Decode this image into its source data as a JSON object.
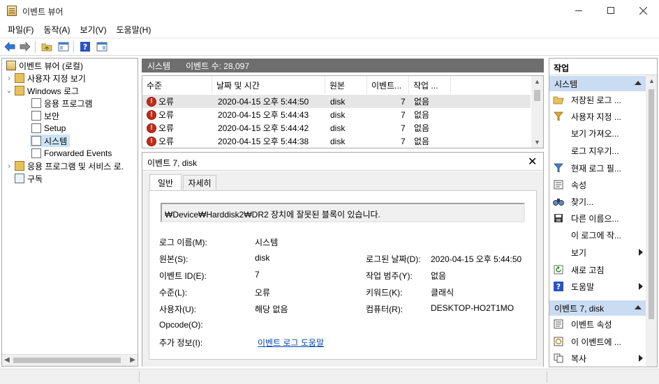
{
  "window": {
    "title": "이벤트 뷰어"
  },
  "menu": [
    "파일(F)",
    "동작(A)",
    "보기(V)",
    "도움말(H)"
  ],
  "tree": {
    "root": "이벤트 뷰어 (로컬)",
    "custom_views": "사용자 지정 보기",
    "windows_logs": "Windows 로그",
    "logs": [
      "응용 프로그램",
      "보안",
      "Setup",
      "시스템",
      "Forwarded Events"
    ],
    "app_services": "응용 프로그램 및 서비스 로.",
    "subscriptions": "구독"
  },
  "middle": {
    "log_name": "시스템",
    "event_count": "이벤트 수: 28,097"
  },
  "grid": {
    "columns": [
      "수준",
      "날짜 및 시간",
      "원본",
      "이벤트...",
      "작업 ..."
    ],
    "rows": [
      {
        "level": "오류",
        "datetime": "2020-04-15 오후 5:44:50",
        "source": "disk",
        "id": "7",
        "task": "없음"
      },
      {
        "level": "오류",
        "datetime": "2020-04-15 오후 5:44:43",
        "source": "disk",
        "id": "7",
        "task": "없음"
      },
      {
        "level": "오류",
        "datetime": "2020-04-15 오후 5:44:42",
        "source": "disk",
        "id": "7",
        "task": "없음"
      },
      {
        "level": "오류",
        "datetime": "2020-04-15 오후 5:44:38",
        "source": "disk",
        "id": "7",
        "task": "없음"
      }
    ]
  },
  "detail": {
    "title": "이벤트 7, disk",
    "tabs": [
      "일반",
      "자세히"
    ],
    "message": "₩Device₩Harddisk2₩DR2 장치에 잘못된 블록이 있습니다.",
    "fields": {
      "log_name_label": "로그 이름(M):",
      "log_name": "시스템",
      "source_label": "원본(S):",
      "source": "disk",
      "logged_label": "로그된 날짜(D):",
      "logged": "2020-04-15 오후 5:44:50",
      "event_id_label": "이벤트 ID(E):",
      "event_id": "7",
      "task_cat_label": "작업 범주(Y):",
      "task_cat": "없음",
      "level_label": "수준(L):",
      "level": "오류",
      "keywords_label": "키워드(K):",
      "keywords": "클래식",
      "user_label": "사용자(U):",
      "user": "해당 없음",
      "computer_label": "컴퓨터(R):",
      "computer": "DESKTOP-HO2T1MO",
      "opcode_label": "Opcode(O):",
      "more_info_label": "추가 정보(I):",
      "more_info_link": "이벤트 로그 도움말"
    }
  },
  "actions": {
    "title": "작업",
    "section1": "시스템",
    "items1": [
      "저장된 로그 ...",
      "사용자 지정 ...",
      "보기 가져오...",
      "로그 지우기...",
      "현재 로그 필...",
      "속성",
      "찾기...",
      "다른 이름으...",
      "이 로그에 작...",
      "보기",
      "새로 고침",
      "도움말"
    ],
    "section2": "이벤트 7, disk",
    "items2": [
      "이벤트 속성",
      "이 이벤트에 ...",
      "복사"
    ]
  },
  "colors": {
    "section_bg": "#c9dcf2",
    "header_bg": "#6e6e6e",
    "error_red": "#c42b1c",
    "link": "#0645ad"
  }
}
